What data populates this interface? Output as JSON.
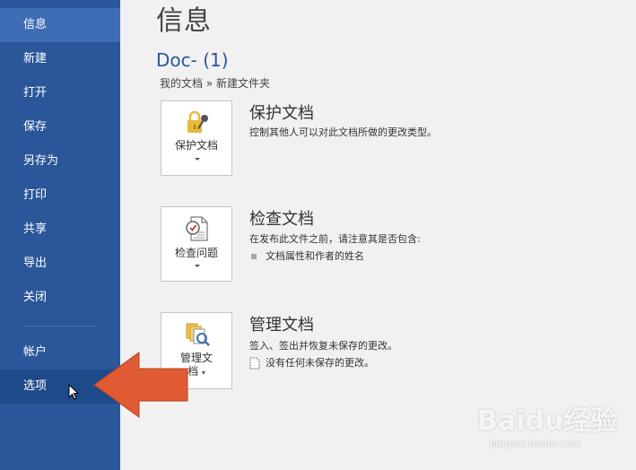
{
  "sidebar": {
    "items": [
      {
        "label": "信息"
      },
      {
        "label": "新建"
      },
      {
        "label": "打开"
      },
      {
        "label": "保存"
      },
      {
        "label": "另存为"
      },
      {
        "label": "打印"
      },
      {
        "label": "共享"
      },
      {
        "label": "导出"
      },
      {
        "label": "关闭"
      },
      {
        "label": "帐户"
      },
      {
        "label": "选项"
      }
    ],
    "active_item": "信息",
    "hover_item": "选项"
  },
  "main": {
    "title": "信息",
    "doc_name": "Doc- (1)",
    "breadcrumb": "我的文档 » 新建文件夹",
    "sections": {
      "protect": {
        "button_label": "保护文档",
        "title": "保护文档",
        "description": "控制其他人可以对此文档所做的更改类型。"
      },
      "inspect": {
        "button_label": "检查问题",
        "title": "检查文档",
        "description": "在发布此文件之前，请注意其是否包含:",
        "bullets": [
          "文档属性和作者的姓名"
        ]
      },
      "manage": {
        "button_label_line1": "管理文",
        "button_label_line2": "档",
        "title": "管理文档",
        "description": "签入、签出并恢复未保存的更改。",
        "note": "没有任何未保存的更改。"
      }
    }
  },
  "colors": {
    "sidebar_bg": "#2b579a",
    "accent": "#2b579a",
    "arrow": "#e05a33"
  },
  "watermark": {
    "brand": "Baidu经验",
    "url": "jingyan.baidu.com"
  }
}
